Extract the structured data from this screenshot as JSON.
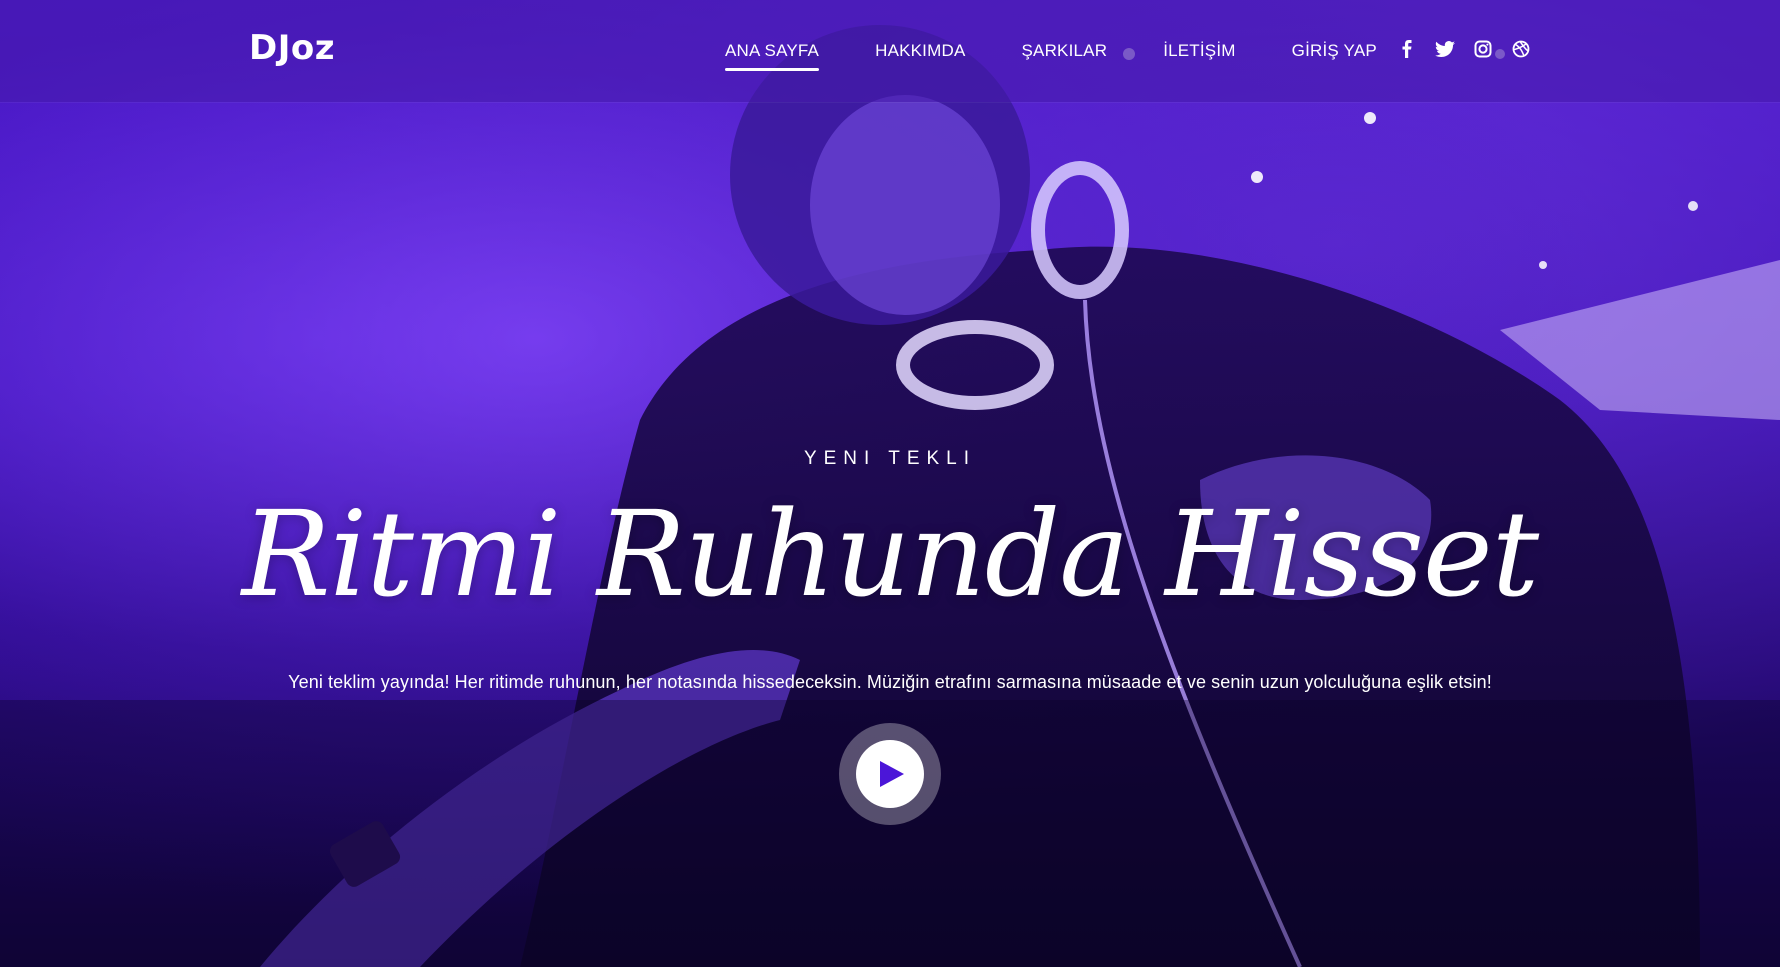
{
  "brand": {
    "logo": "DJoz"
  },
  "nav": {
    "items": [
      {
        "label": "ANA SAYFA",
        "active": true
      },
      {
        "label": "HAKKIMDA",
        "active": false
      },
      {
        "label": "ŞARKILAR",
        "active": false
      },
      {
        "label": "İLETİŞİM",
        "active": false
      },
      {
        "label": "GİRİŞ YAP",
        "active": false
      }
    ]
  },
  "social": {
    "icons": [
      "facebook-icon",
      "twitter-icon",
      "instagram-icon",
      "dribbble-icon"
    ]
  },
  "hero": {
    "eyebrow": "YENI TEKLI",
    "title": "Ritmi Ruhunda Hisset",
    "tagline": "Yeni teklim yayında! Her ritimde ruhunun, her notasında hissedeceksin. Müziğin etrafını sarmasına müsaade et ve senin uzun yolculuğuna eşlik etsin!",
    "play_icon": "play-icon"
  },
  "colors": {
    "accent": "#4b16d8",
    "nav_bg": "#4619aa",
    "text": "#ffffff"
  }
}
